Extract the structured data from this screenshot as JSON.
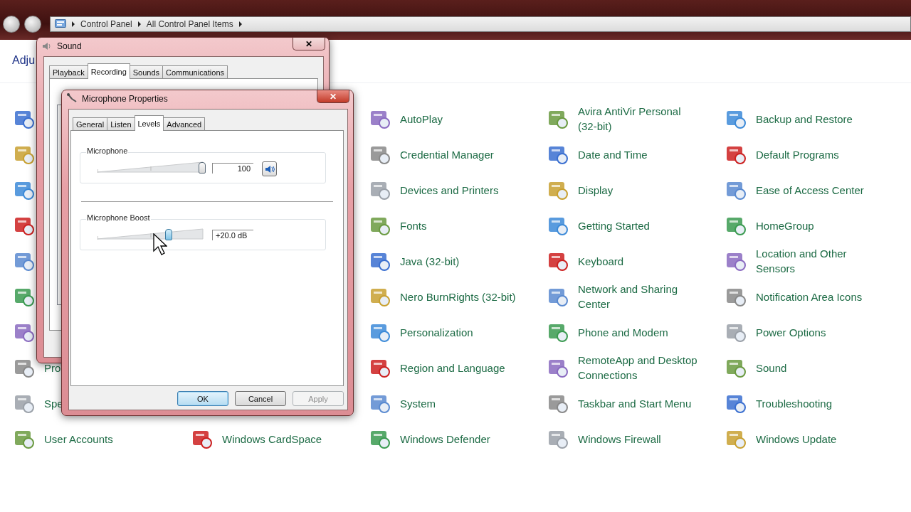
{
  "address_bar": {
    "breadcrumb": [
      "Control Panel",
      "All Control Panel Items"
    ]
  },
  "heading": "Adju",
  "columns": [
    [
      {
        "kind": "icon"
      },
      {
        "kind": "icon"
      },
      {
        "kind": "icon"
      },
      {
        "kind": "icon"
      },
      {
        "kind": "icon"
      },
      {
        "kind": "icon"
      },
      {
        "kind": "icon"
      },
      {
        "kind": "link",
        "label": "Pro"
      },
      {
        "kind": "link",
        "label": "Spe"
      },
      {
        "kind": "link",
        "label": "User Accounts"
      }
    ],
    [
      {
        "kind": "link",
        "label": "Windows CardSpace"
      }
    ],
    [
      {
        "kind": "link",
        "label": "AutoPlay"
      },
      {
        "kind": "link",
        "label": "Credential Manager"
      },
      {
        "kind": "link",
        "label": "Devices and Printers"
      },
      {
        "kind": "link",
        "label": "Fonts"
      },
      {
        "kind": "link",
        "label": "Java (32-bit)"
      },
      {
        "kind": "link",
        "label": "Nero BurnRights (32-bit)"
      },
      {
        "kind": "link",
        "label": "Personalization"
      },
      {
        "kind": "link",
        "label": "Region and Language"
      },
      {
        "kind": "link",
        "label": "System"
      },
      {
        "kind": "link",
        "label": "Windows Defender"
      }
    ],
    [
      {
        "kind": "link",
        "label": "Avira AntiVir Personal (32-bit)"
      },
      {
        "kind": "link",
        "label": "Date and Time"
      },
      {
        "kind": "link",
        "label": "Display"
      },
      {
        "kind": "link",
        "label": "Getting Started"
      },
      {
        "kind": "link",
        "label": "Keyboard"
      },
      {
        "kind": "link",
        "label": "Network and Sharing Center"
      },
      {
        "kind": "link",
        "label": "Phone and Modem"
      },
      {
        "kind": "link",
        "label": "RemoteApp and Desktop Connections"
      },
      {
        "kind": "link",
        "label": "Taskbar and Start Menu"
      },
      {
        "kind": "link",
        "label": "Windows Firewall"
      }
    ],
    [
      {
        "kind": "link",
        "label": "Backup and Restore"
      },
      {
        "kind": "link",
        "label": "Default Programs"
      },
      {
        "kind": "link",
        "label": "Ease of Access Center"
      },
      {
        "kind": "link",
        "label": "HomeGroup"
      },
      {
        "kind": "link",
        "label": "Location and Other Sensors"
      },
      {
        "kind": "link",
        "label": "Notification Area Icons"
      },
      {
        "kind": "link",
        "label": "Power Options"
      },
      {
        "kind": "link",
        "label": "Sound"
      },
      {
        "kind": "link",
        "label": "Troubleshooting"
      },
      {
        "kind": "link",
        "label": "Windows Update"
      }
    ]
  ],
  "sound_dialog": {
    "title": "Sound",
    "close": "✕",
    "tabs": [
      {
        "label": "Playback",
        "selected": false
      },
      {
        "label": "Recording",
        "selected": true
      },
      {
        "label": "Sounds",
        "selected": false
      },
      {
        "label": "Communications",
        "selected": false
      }
    ]
  },
  "properties_dialog": {
    "title": "Microphone Properties",
    "close": "✕",
    "tabs": [
      {
        "label": "General",
        "selected": false
      },
      {
        "label": "Listen",
        "selected": false
      },
      {
        "label": "Levels",
        "selected": true
      },
      {
        "label": "Advanced",
        "selected": false
      }
    ],
    "controls": [
      {
        "label": "Microphone",
        "level": 1.0,
        "value": "100",
        "mute_button": true
      },
      {
        "label": "Microphone Boost",
        "level": 0.67,
        "value": "+20.0 dB",
        "mute_button": false
      }
    ],
    "buttons": [
      {
        "label": "OK",
        "default": true,
        "disabled": false
      },
      {
        "label": "Cancel",
        "default": false,
        "disabled": false
      },
      {
        "label": "Apply",
        "default": false,
        "disabled": true
      }
    ]
  }
}
